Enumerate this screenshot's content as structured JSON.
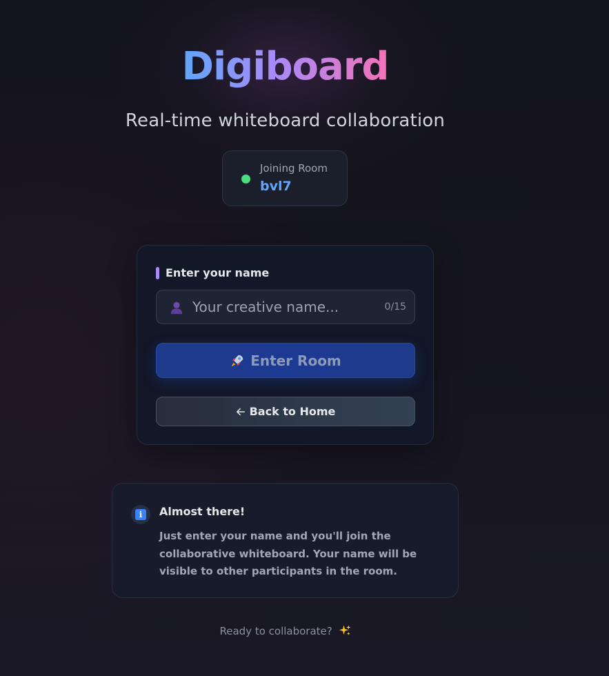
{
  "brand": {
    "title": "Digiboard",
    "subtitle": "Real-time whiteboard collaboration",
    "gradient_colors": [
      "#60a5fa",
      "#a78bfa",
      "#f472b6"
    ]
  },
  "room": {
    "label": "Joining Room",
    "code": "bvl7",
    "status_color": "#4ade80"
  },
  "form": {
    "label": "Enter your name",
    "input_placeholder": "Your creative name...",
    "input_value": "",
    "char_count": "0/15",
    "user_icon": "user-icon",
    "enter_button_label": "Enter Room",
    "enter_button_icon": "rocket-icon",
    "back_button_label": "Back to Home",
    "back_button_icon": "arrow-left-icon"
  },
  "info": {
    "icon": "info-icon",
    "title": "Almost there!",
    "body": "Just enter your name and you'll join the collaborative whiteboard. Your name will be visible to other participants in the room."
  },
  "footer": {
    "text": "Ready to collaborate?",
    "icon": "sparkles-icon"
  },
  "colors": {
    "accent_blue": "#60a5fa",
    "accent_purple": "#a78bfa",
    "primary_button": "#1e3a8a"
  }
}
